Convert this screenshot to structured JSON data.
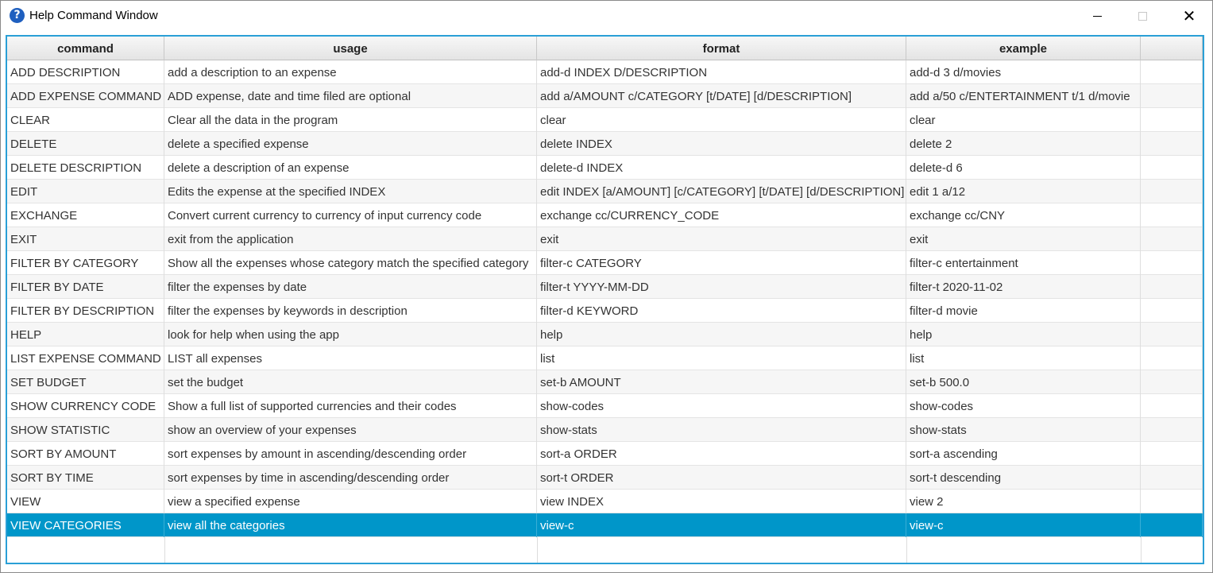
{
  "window": {
    "title": "Help Command Window",
    "icon": "help-question-icon",
    "controls": {
      "minimize": "minimize",
      "maximize": "maximize",
      "close": "✕"
    }
  },
  "colors": {
    "selection": "#0096c9",
    "frame_border": "#2a9fd6"
  },
  "table": {
    "columns": [
      "command",
      "usage",
      "format",
      "example"
    ],
    "rows": [
      {
        "command": "ADD DESCRIPTION",
        "usage": "add a description to an expense",
        "format": "add-d INDEX D/DESCRIPTION",
        "example": "add-d 3 d/movies"
      },
      {
        "command": "ADD EXPENSE COMMAND",
        "usage": "ADD expense, date and time filed are optional",
        "format": "add a/AMOUNT c/CATEGORY [t/DATE] [d/DESCRIPTION]",
        "example": "add a/50 c/ENTERTAINMENT t/1 d/movie"
      },
      {
        "command": "CLEAR",
        "usage": "Clear all the data in the program",
        "format": "clear",
        "example": "clear"
      },
      {
        "command": "DELETE",
        "usage": "delete a specified expense",
        "format": "delete INDEX",
        "example": "delete 2"
      },
      {
        "command": "DELETE DESCRIPTION",
        "usage": "delete a description of an expense",
        "format": "delete-d INDEX",
        "example": "delete-d 6"
      },
      {
        "command": "EDIT",
        "usage": "Edits the expense at the specified INDEX",
        "format": "edit INDEX [a/AMOUNT] [c/CATEGORY] [t/DATE] [d/DESCRIPTION]",
        "example": "edit 1 a/12"
      },
      {
        "command": "EXCHANGE",
        "usage": "Convert current currency to currency of input currency code",
        "format": "exchange cc/CURRENCY_CODE",
        "example": "exchange cc/CNY"
      },
      {
        "command": "EXIT",
        "usage": "exit from the application",
        "format": "exit",
        "example": "exit"
      },
      {
        "command": "FILTER BY CATEGORY",
        "usage": "Show all the expenses whose category match the specified category",
        "format": "filter-c CATEGORY",
        "example": "filter-c entertainment"
      },
      {
        "command": "FILTER BY DATE",
        "usage": "filter the expenses by date",
        "format": "filter-t YYYY-MM-DD",
        "example": "filter-t 2020-11-02"
      },
      {
        "command": "FILTER BY DESCRIPTION",
        "usage": "filter the expenses by keywords in description",
        "format": "filter-d KEYWORD",
        "example": "filter-d movie"
      },
      {
        "command": "HELP",
        "usage": "look for help when using the app",
        "format": "help",
        "example": "help"
      },
      {
        "command": "LIST EXPENSE COMMAND",
        "usage": "LIST all expenses",
        "format": "list",
        "example": "list"
      },
      {
        "command": "SET BUDGET",
        "usage": "set the budget",
        "format": "set-b AMOUNT",
        "example": "set-b 500.0"
      },
      {
        "command": "SHOW CURRENCY CODE",
        "usage": "Show a full list of supported currencies and their codes",
        "format": "show-codes",
        "example": "show-codes"
      },
      {
        "command": "SHOW STATISTIC",
        "usage": "show an overview of your expenses",
        "format": "show-stats",
        "example": "show-stats"
      },
      {
        "command": "SORT BY AMOUNT",
        "usage": "sort expenses by amount in ascending/descending order",
        "format": "sort-a ORDER",
        "example": "sort-a ascending"
      },
      {
        "command": "SORT BY TIME",
        "usage": "sort expenses by time in ascending/descending order",
        "format": "sort-t ORDER",
        "example": "sort-t descending"
      },
      {
        "command": "VIEW",
        "usage": "view a specified expense",
        "format": "view INDEX",
        "example": "view 2"
      },
      {
        "command": "VIEW CATEGORIES",
        "usage": "view all the categories",
        "format": "view-c",
        "example": "view-c"
      }
    ],
    "selected_index": 19
  }
}
